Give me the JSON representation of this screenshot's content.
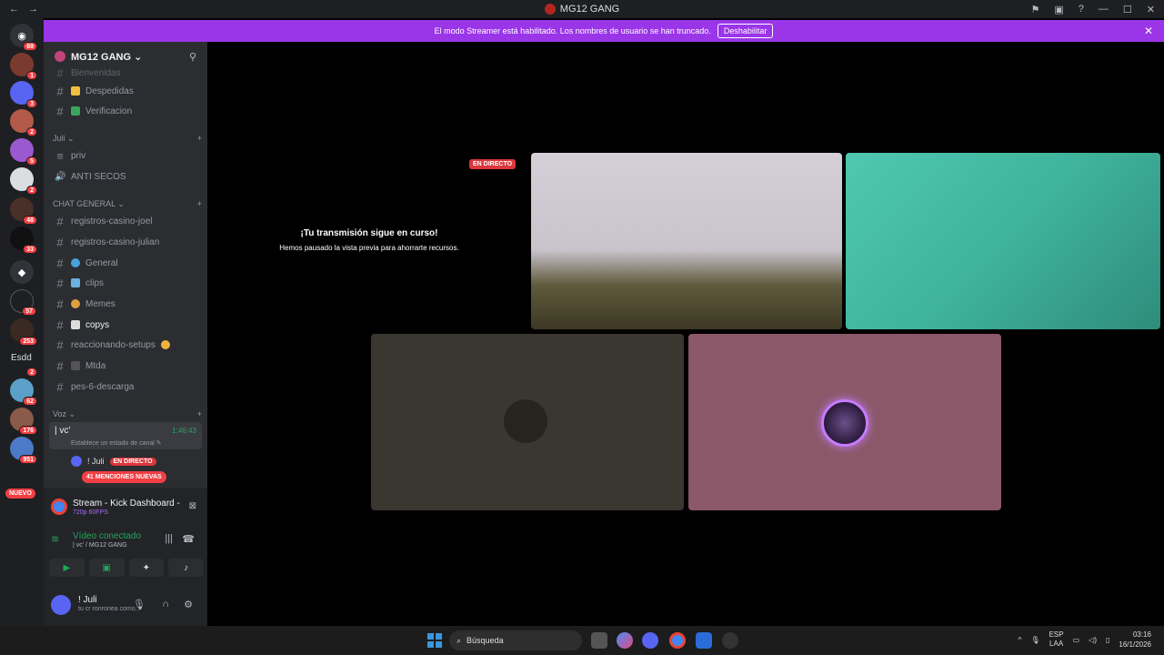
{
  "window": {
    "title": "MG12 GANG",
    "nav_back": "←",
    "nav_forward": "→",
    "tool_icons": [
      "⚑",
      "▣",
      "?",
      "—",
      "☐",
      "✕"
    ]
  },
  "banner": {
    "text": "El modo Streamer está habilitado. Los nombres de usuario se han truncado.",
    "button": "Deshabilitar",
    "close": "✕"
  },
  "guilds": {
    "badges": [
      "69",
      "1",
      "3",
      "2",
      "5",
      "2",
      "48",
      "33",
      "57",
      "253",
      "2",
      "62",
      "176",
      "951"
    ],
    "text_item": "Esdd",
    "new_pill": "NUEVO"
  },
  "server": {
    "name": "MG12 GANG ⌄",
    "invite_icon": "person-plus-icon"
  },
  "channels_top": [
    {
      "label": "Bienvenidas"
    },
    {
      "label": "Despedidas"
    },
    {
      "label": "Verificacion"
    }
  ],
  "category_juli": {
    "label": "Juli ⌄",
    "add": "+"
  },
  "juli_channels": [
    {
      "label": "priv",
      "icon": "≡"
    },
    {
      "label": "ANTI SECOS",
      "icon": "🔊"
    }
  ],
  "category_chat": {
    "label": "CHAT GENERAL ⌄",
    "add": "+"
  },
  "chat_channels": [
    {
      "label": "registros-casino-joel"
    },
    {
      "label": "registros-casino-julian"
    },
    {
      "label": "General"
    },
    {
      "label": "clips"
    },
    {
      "label": "Memes"
    },
    {
      "label": "copys"
    },
    {
      "label": "reaccionando-setups"
    },
    {
      "label": "Mtda"
    },
    {
      "label": "pes-6-descarga"
    }
  ],
  "category_voz": {
    "label": "Voz ⌄",
    "add": "+"
  },
  "voice_channel": {
    "name": "| vc'",
    "time": "1:46:43",
    "status": "Establece un estado de canal ✎"
  },
  "voice_user": {
    "name": "! Juli",
    "live": "EN DIRECTO"
  },
  "mentions": "41 MENCIONES NUEVAS",
  "stream_panel": {
    "title": "Stream - Kick Dashboard - Go...",
    "quality": "720p 60FPS"
  },
  "voice_panel": {
    "status": "Vídeo conectado",
    "location": "| vc' / MG12 GANG"
  },
  "user_panel": {
    "name": "! Juli",
    "status": "tu cr ronronea como..."
  },
  "stage": {
    "paused_title": "¡Tu transmisión sigue en curso!",
    "paused_sub": "Hemos pausado la vista previa para ahorrarte recursos.",
    "live_tag": "EN DIRECTO"
  },
  "taskbar": {
    "search": "Búsqueda",
    "lang1": "ESP",
    "lang2": "LAA",
    "time": "03:16",
    "date": "16/1/2026"
  }
}
